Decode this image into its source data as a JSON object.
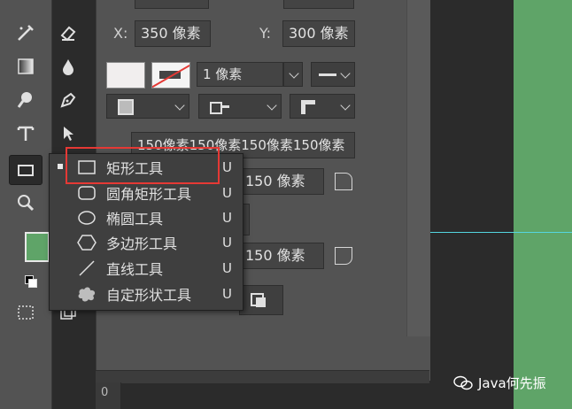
{
  "position": {
    "x_label": "X:",
    "x_value": "350 像素",
    "y_label": "Y:",
    "y_value": "300 像素"
  },
  "stroke": {
    "width": "1 像素"
  },
  "radius": {
    "all_corners": "150像素150像素150像素150像素",
    "top_left": "150 像素",
    "bottom_left": "150 像素"
  },
  "flyout": {
    "items": [
      {
        "label": "矩形工具",
        "key": "U",
        "icon": "rectangle-icon"
      },
      {
        "label": "圆角矩形工具",
        "key": "U",
        "icon": "rounded-rectangle-icon"
      },
      {
        "label": "椭圆工具",
        "key": "U",
        "icon": "ellipse-icon"
      },
      {
        "label": "多边形工具",
        "key": "U",
        "icon": "polygon-icon"
      },
      {
        "label": "直线工具",
        "key": "U",
        "icon": "line-icon"
      },
      {
        "label": "自定形状工具",
        "key": "U",
        "icon": "custom-shape-icon"
      }
    ]
  },
  "ruler": {
    "value": "0"
  },
  "watermark": {
    "text": "Java何先振"
  },
  "colors": {
    "foreground": "#5fa468",
    "highlight": "#e53935",
    "guide": "#54d6df"
  }
}
